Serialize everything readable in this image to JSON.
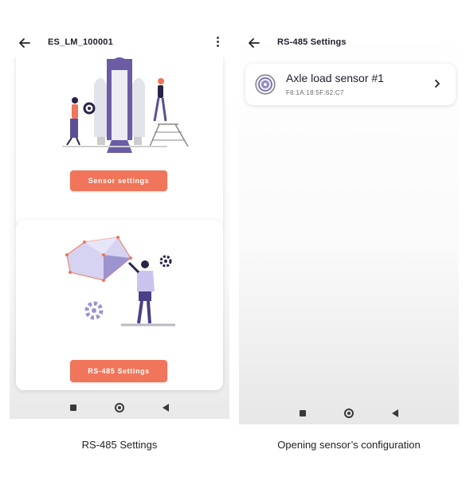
{
  "left_screen": {
    "title": "ES_LM_100001",
    "sensor_button_label": "Sensor settings",
    "rs485_button_label": "RS-485 Settings",
    "caption": "RS-485 Settings"
  },
  "right_screen": {
    "title": "RS-485 Settings",
    "sensors": [
      {
        "name": "Axle load sensor #1",
        "mac": "F6:1A:18:5F:62:C7"
      }
    ],
    "caption": "Opening sensor’s configuration"
  },
  "colors": {
    "accent": "#f0755a",
    "illustration_purple": "#6b5ca5",
    "illustration_light": "#c9c3ee"
  },
  "icons": [
    "back-arrow-icon",
    "more-vert-icon",
    "sensor-icon",
    "chevron-right-icon",
    "nav-recents-icon",
    "nav-home-icon",
    "nav-back-icon"
  ]
}
